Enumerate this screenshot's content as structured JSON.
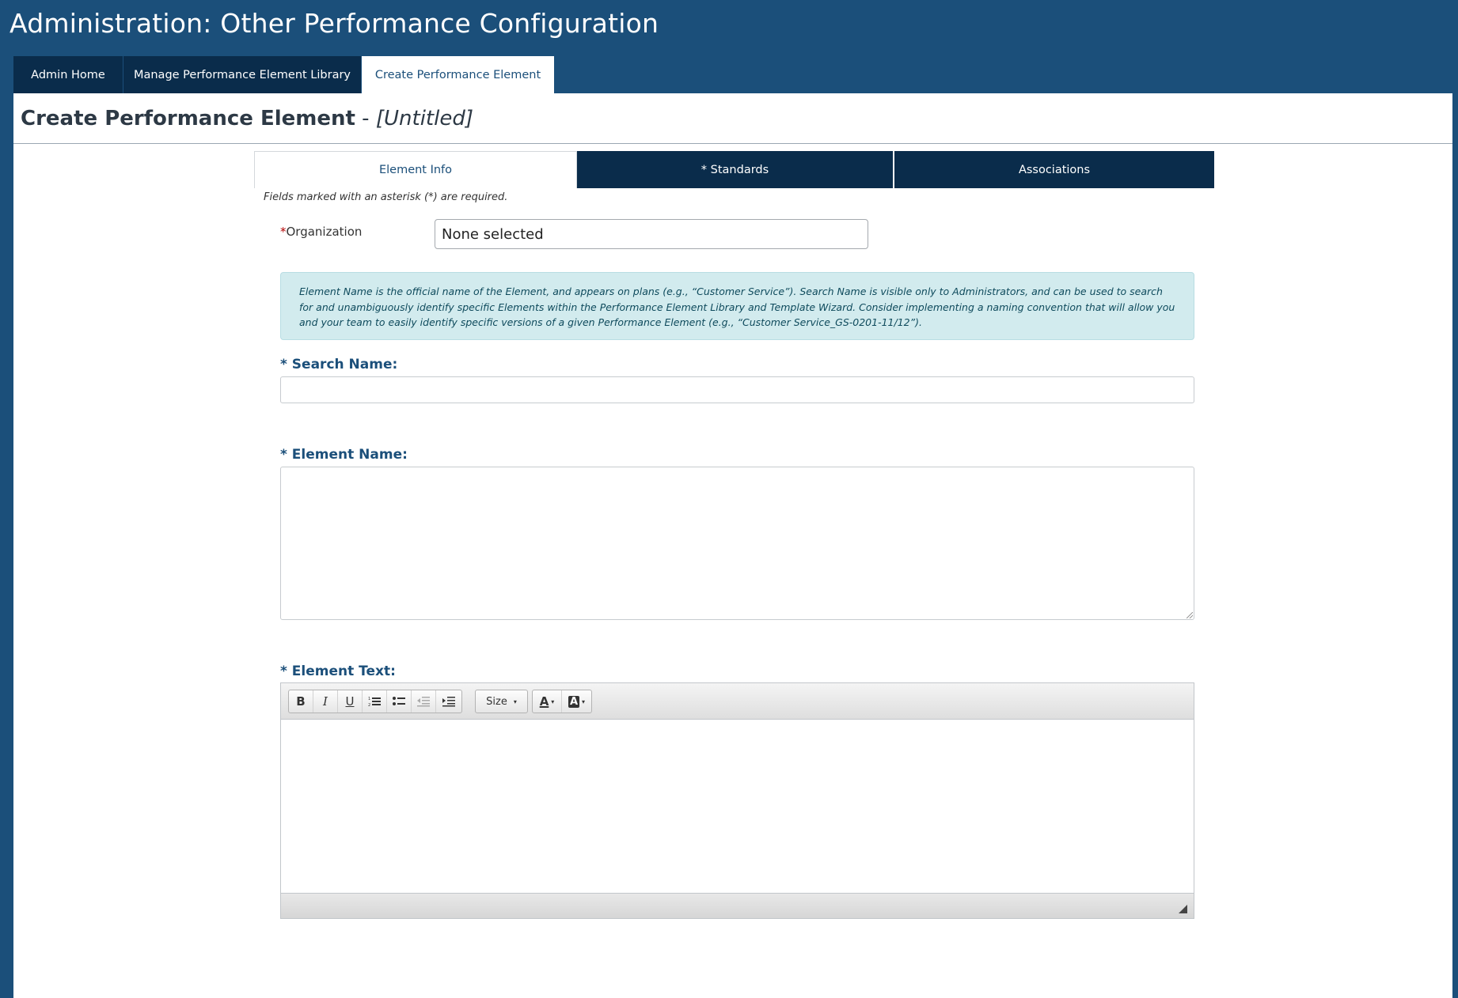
{
  "app": {
    "title": "Administration: Other Performance Configuration"
  },
  "nav_tabs": [
    {
      "label": "Admin Home"
    },
    {
      "label": "Manage Performance Element Library"
    },
    {
      "label": "Create Performance Element",
      "active": true
    }
  ],
  "page": {
    "heading": "Create Performance Element",
    "separator": " - ",
    "subtitle": "[Untitled]"
  },
  "sub_tabs": [
    {
      "label": "Element Info",
      "active": true
    },
    {
      "label": "* Standards"
    },
    {
      "label": "Associations"
    }
  ],
  "form": {
    "required_note": "Fields marked with an asterisk (*) are required.",
    "organization": {
      "star": "*",
      "label": "Organization",
      "value": "None selected"
    },
    "info_text": "Element Name is the official name of the Element, and appears on plans (e.g., “Customer Service”). Search Name is visible only to Administrators, and can be used to search for and unambiguously identify specific Elements within the Performance Element Library and Template Wizard. Consider implementing a naming convention that will allow you and your team to easily identify specific versions of a given Performance Element (e.g., “Customer Service_GS-0201-11/12”).",
    "search_name": {
      "label": "* Search Name:",
      "value": ""
    },
    "element_name": {
      "label": "* Element Name:",
      "value": ""
    },
    "element_text": {
      "label": "* Element Text:",
      "value": ""
    }
  },
  "editor_toolbar": {
    "bold": "B",
    "italic": "I",
    "underline": "U",
    "size_label": "Size",
    "font_color_glyph": "A",
    "highlight_glyph": "A",
    "caret": "▾",
    "icons": [
      "bold-icon",
      "italic-icon",
      "underline-icon",
      "ordered-list-icon",
      "unordered-list-icon",
      "outdent-icon",
      "indent-icon",
      "font-color-icon",
      "highlight-color-icon"
    ]
  },
  "colors": {
    "header_bg": "#1b4f7a",
    "tab_dark": "#0a2c4b",
    "label_blue": "#1b4f7a",
    "info_bg": "#d2ebee",
    "required_star": "#b20000"
  }
}
